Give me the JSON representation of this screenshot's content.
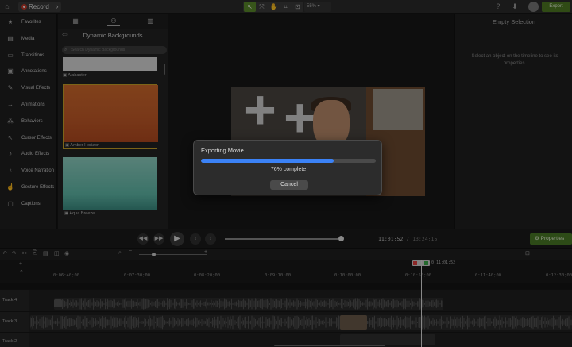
{
  "app": {
    "record_label": "Record",
    "zoom_value": "55%",
    "export_label": "Export"
  },
  "sidebar": {
    "items": [
      {
        "label": "Favorites",
        "icon": "star-icon",
        "glyph": "★"
      },
      {
        "label": "Media",
        "icon": "media-icon",
        "glyph": "▤"
      },
      {
        "label": "Transitions",
        "icon": "transitions-icon",
        "glyph": "▭"
      },
      {
        "label": "Annotations",
        "icon": "annotations-icon",
        "glyph": "▣"
      },
      {
        "label": "Visual Effects",
        "icon": "visual-effects-icon",
        "glyph": "✎"
      },
      {
        "label": "Animations",
        "icon": "animations-icon",
        "glyph": "→"
      },
      {
        "label": "Behaviors",
        "icon": "behaviors-icon",
        "glyph": "⁂"
      },
      {
        "label": "Cursor Effects",
        "icon": "cursor-effects-icon",
        "glyph": "↖"
      },
      {
        "label": "Audio Effects",
        "icon": "audio-effects-icon",
        "glyph": "♪"
      },
      {
        "label": "Voice Narration",
        "icon": "microphone-icon",
        "glyph": "♁"
      },
      {
        "label": "Gesture Effects",
        "icon": "gesture-icon",
        "glyph": "☝"
      },
      {
        "label": "Captions",
        "icon": "captions-icon",
        "glyph": "▢"
      }
    ]
  },
  "library": {
    "title": "Dynamic Backgrounds",
    "search_placeholder": "Search Dynamic Backgrounds",
    "items": [
      {
        "label": "Alabaster",
        "color": "#d8d8d8"
      },
      {
        "label": "Amber Horizon",
        "color": "#c25a28"
      },
      {
        "label": "Aqua Breeze",
        "color": "#5fb9a8"
      }
    ]
  },
  "properties": {
    "title": "Empty Selection",
    "message": "Select an object on the timeline to see its properties.",
    "button_label": "Properties"
  },
  "export_dialog": {
    "title": "Exporting Movie ...",
    "progress": 0.76,
    "percent_label": "76% complete",
    "cancel_label": "Cancel"
  },
  "playback": {
    "time_current": "11:01;52",
    "time_total": "13:24;15",
    "scrub_progress": 0.98
  },
  "timeline": {
    "playhead_time": "0:11:01;52",
    "ticks": [
      "0:06:40;00",
      "0:07:30;00",
      "0:08:20;00",
      "0:09:10;00",
      "0:10:00;00",
      "0:10:50;00",
      "0:11:40;00",
      "0:12:30;00"
    ],
    "tracks": [
      {
        "label": "Track 4"
      },
      {
        "label": "Track 3"
      },
      {
        "label": "Track 2"
      }
    ]
  }
}
